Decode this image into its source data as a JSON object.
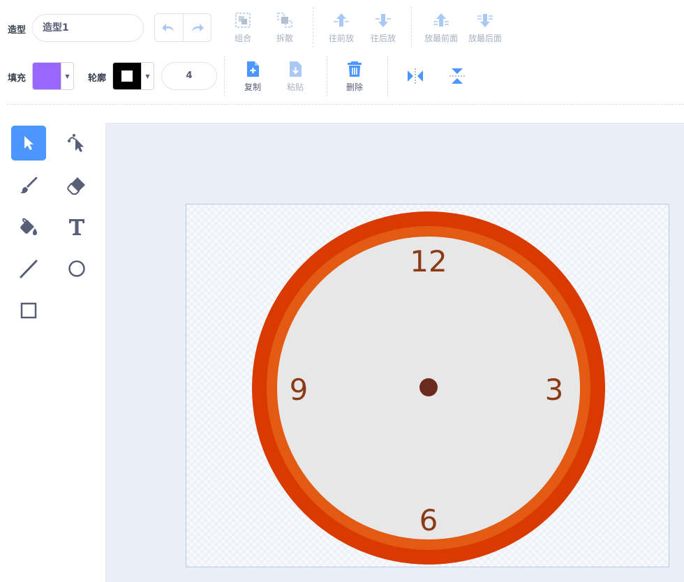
{
  "costume": {
    "label": "造型",
    "name_value": "造型1"
  },
  "arrange_toolbar": {
    "group": "组合",
    "ungroup": "拆散",
    "forward": "往前放",
    "backward": "往后放",
    "front": "放最前面",
    "back": "放最后面"
  },
  "style_toolbar": {
    "fill_label": "填充",
    "fill_color": "#9966ff",
    "outline_label": "轮廓",
    "outline_color": "#000000",
    "outline_width": "4"
  },
  "edit_toolbar": {
    "copy": "复制",
    "paste": "粘贴",
    "delete": "删除"
  },
  "tools": [
    {
      "name": "select",
      "icon": "arrow-pointer-icon",
      "selected": true
    },
    {
      "name": "reshape",
      "icon": "reshape-pointer-icon"
    },
    {
      "name": "brush",
      "icon": "brush-icon"
    },
    {
      "name": "eraser",
      "icon": "eraser-icon"
    },
    {
      "name": "fill",
      "icon": "paint-bucket-icon"
    },
    {
      "name": "text",
      "icon": "text-icon"
    },
    {
      "name": "line",
      "icon": "line-icon"
    },
    {
      "name": "circle",
      "icon": "circle-icon"
    },
    {
      "name": "rectangle",
      "icon": "rectangle-icon"
    }
  ],
  "clock": {
    "numbers": {
      "top": "12",
      "right": "3",
      "bottom": "6",
      "left": "9"
    },
    "outer_ring_color": "#d93a00",
    "inner_ring_color": "#e35a12",
    "face_color": "#e8e7e8",
    "center_color": "#6b2a1e",
    "number_color": "#8b3a16"
  },
  "colors": {
    "accent": "#4c97ff",
    "disabled_icon": "#a9c8f5"
  }
}
